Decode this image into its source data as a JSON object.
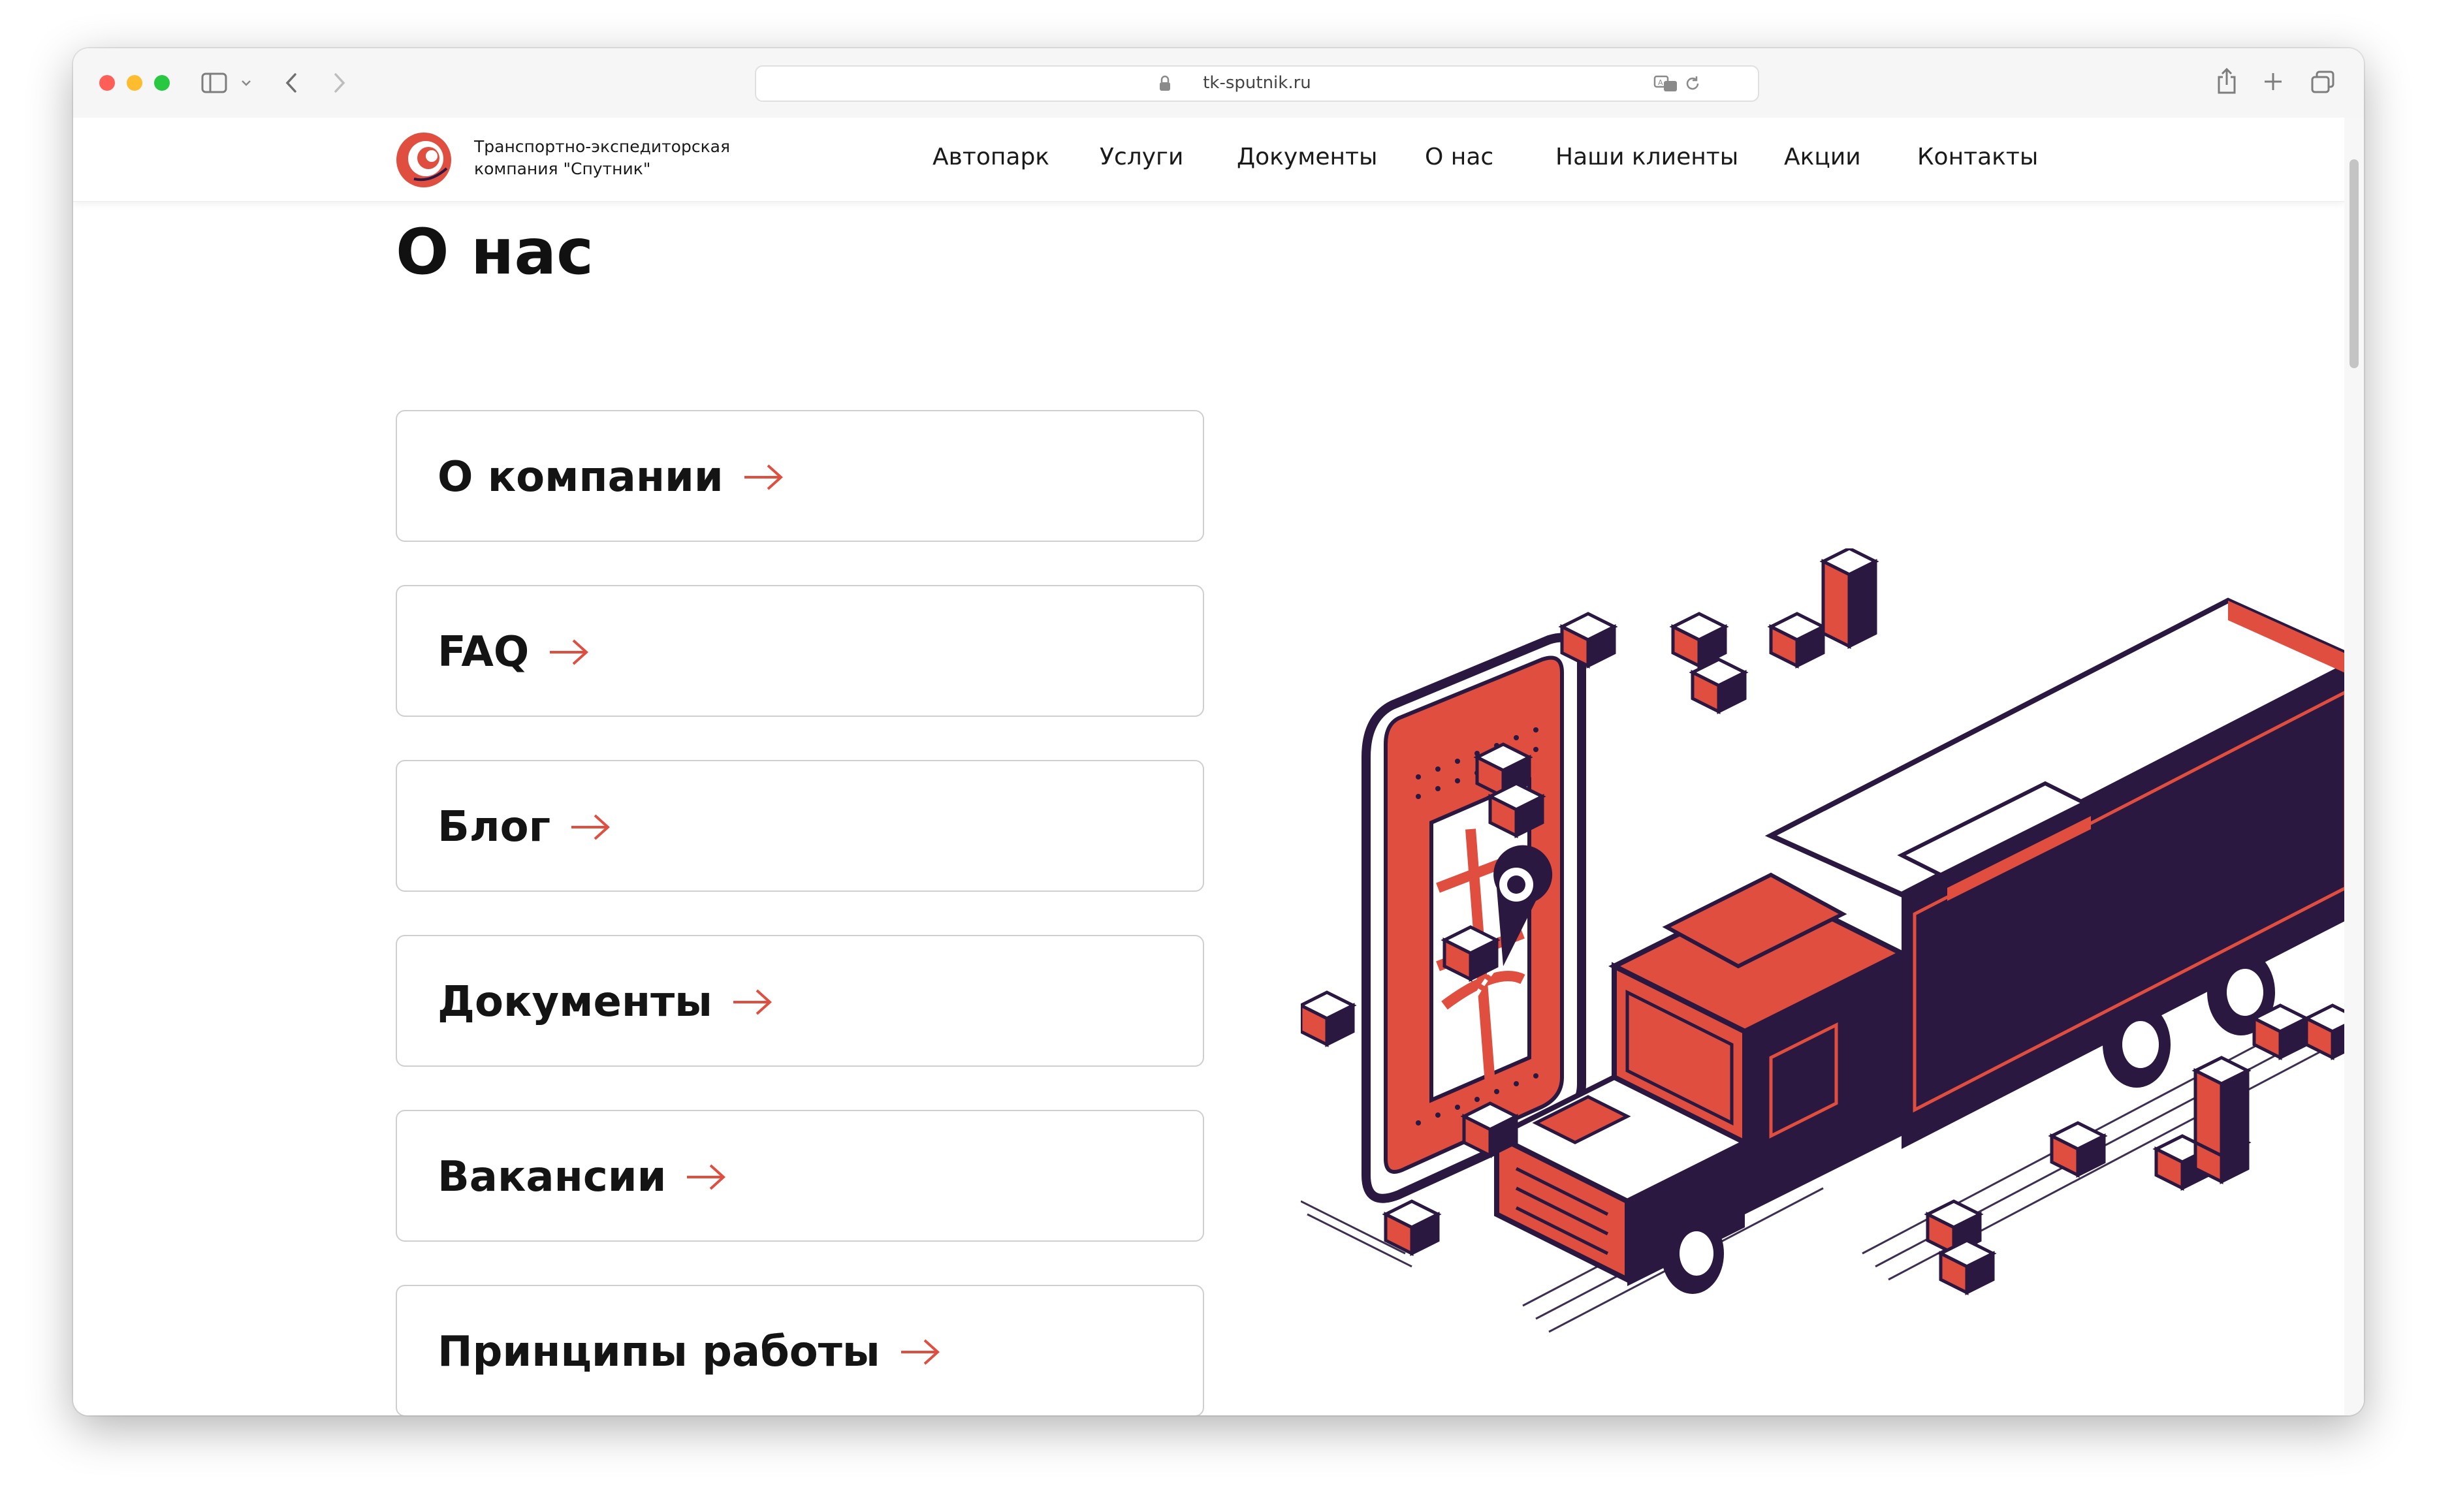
{
  "browser": {
    "url": "tk-sputnik.ru",
    "icons": [
      "sidebar-icon",
      "chevron-down-icon",
      "back-icon",
      "forward-icon",
      "lock-icon",
      "translate-icon",
      "reload-icon",
      "share-icon",
      "new-tab-icon",
      "tabs-overview-icon"
    ]
  },
  "site": {
    "logo_line1": "Транспортно-экспедиторская",
    "logo_line2": "компания \"Спутник\"",
    "nav": [
      "Автопарк",
      "Услуги",
      "Документы",
      "О нас",
      "Наши клиенты",
      "Акции",
      "Контакты"
    ]
  },
  "page": {
    "title": "О нас",
    "cards": [
      "О компании",
      "FAQ",
      "Блог",
      "Документы",
      "Вакансии",
      "Принципы работы"
    ]
  },
  "colors": {
    "accent": "#e04e3f",
    "dark": "#2a1840",
    "text": "#141414"
  }
}
